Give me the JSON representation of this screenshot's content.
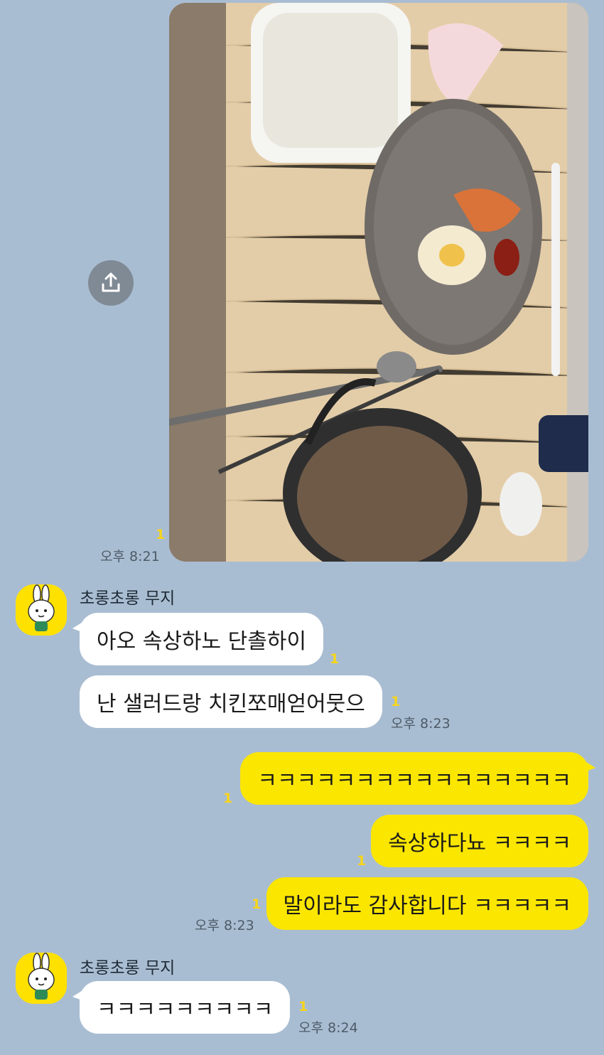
{
  "colors": {
    "background": "#a9bdd2",
    "outgoing_bubble": "#fbe600",
    "incoming_bubble": "#ffffff",
    "unread": "#f7d51a"
  },
  "photo_message": {
    "unread": "1",
    "time": "오후 8:21"
  },
  "share_button": {
    "icon": "share-icon"
  },
  "group1": {
    "sender": "초롱초롱 무지",
    "messages": [
      {
        "text": "아오 속상하노 단촐하이",
        "unread": "1"
      },
      {
        "text": "난 샐러드랑 치킨쪼매얻어뭇으",
        "unread": "1"
      }
    ],
    "time": "오후 8:23"
  },
  "outgoing": {
    "messages": [
      {
        "text": "ㅋㅋㅋㅋㅋㅋㅋㅋㅋㅋㅋㅋㅋㅋㅋㅋ",
        "unread": "1"
      },
      {
        "text": "속상하다뇨 ㅋㅋㅋㅋ",
        "unread": "1"
      },
      {
        "text": "말이라도 감사합니다 ㅋㅋㅋㅋㅋ",
        "unread": "1"
      }
    ],
    "time": "오후 8:23"
  },
  "group2": {
    "sender": "초롱초롱 무지",
    "messages": [
      {
        "text": "ㅋㅋㅋㅋㅋㅋㅋㅋㅋ",
        "unread": "1"
      }
    ],
    "time": "오후 8:24"
  }
}
